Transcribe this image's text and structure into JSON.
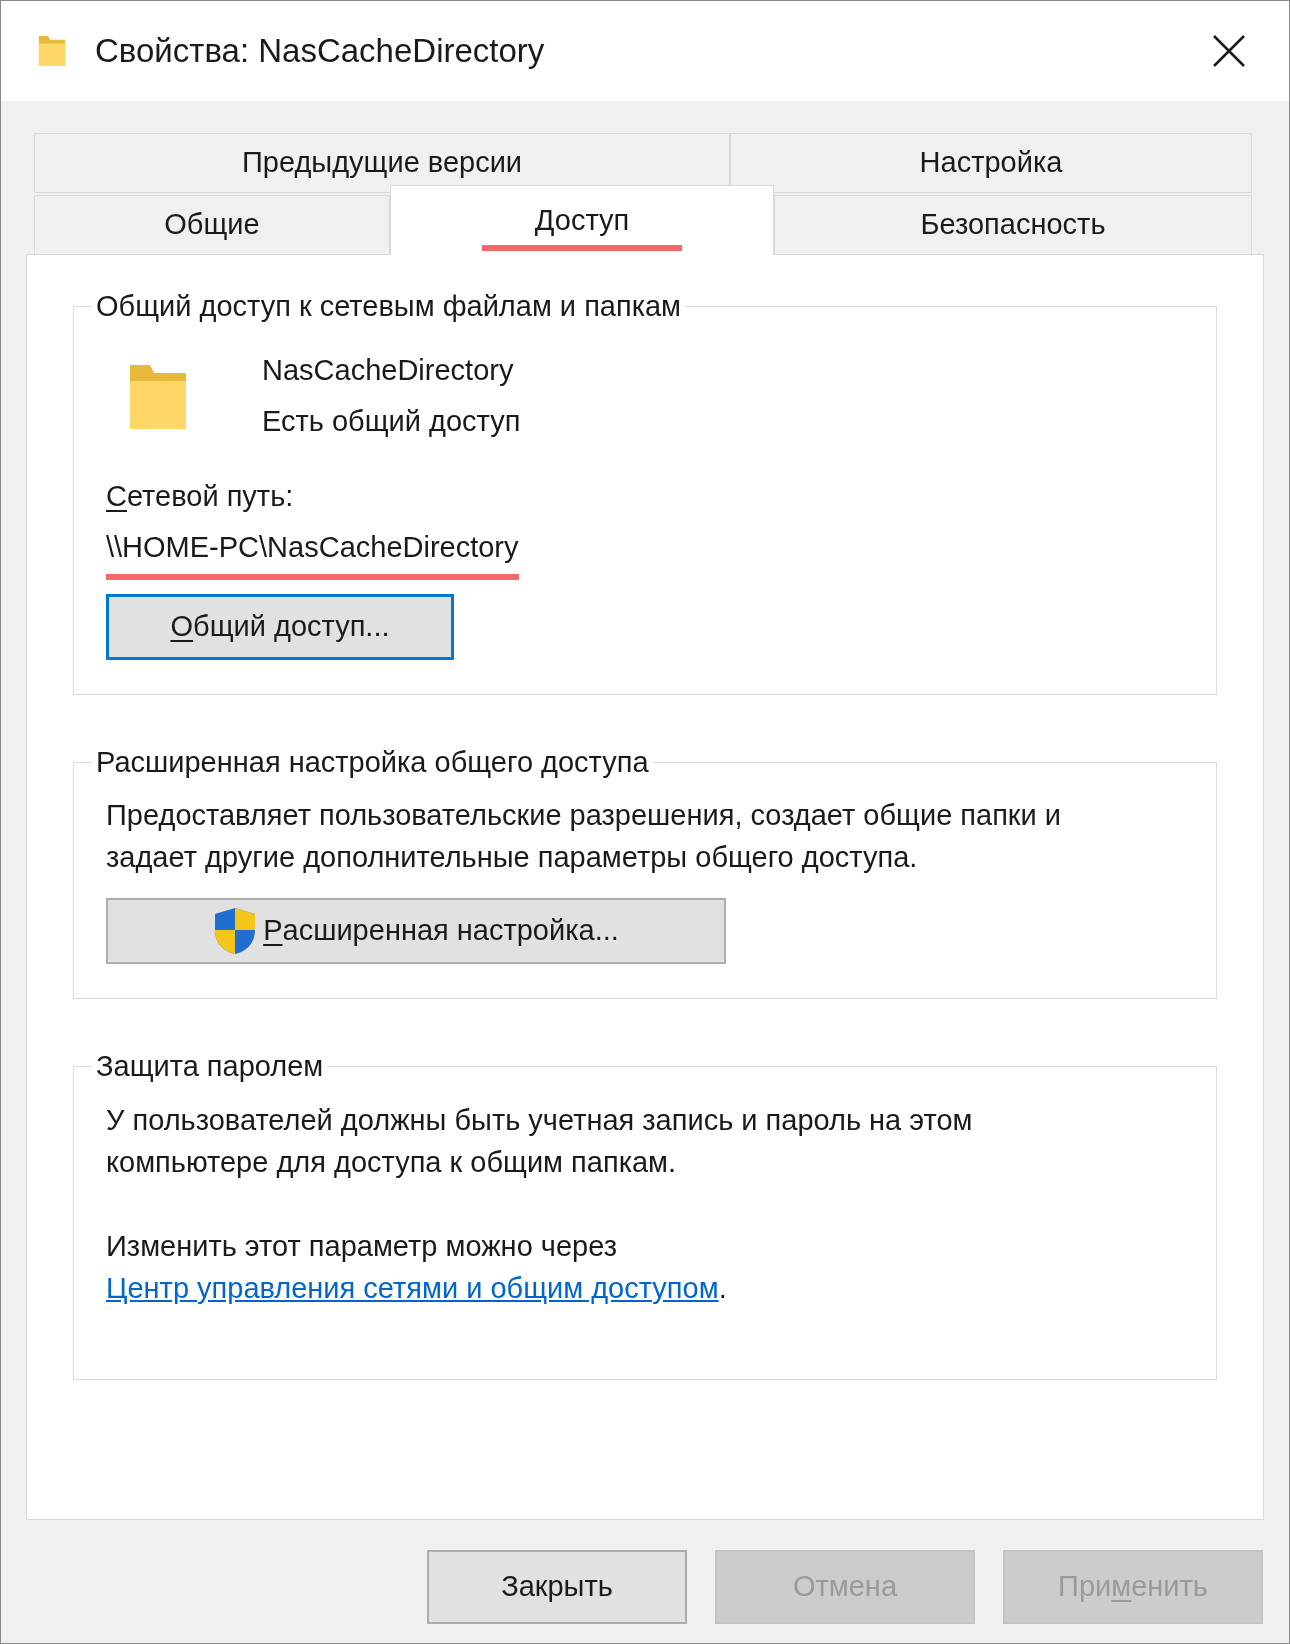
{
  "window": {
    "title": "Свойства: NasCacheDirectory"
  },
  "tab_rows": [
    [
      {
        "label": "Предыдущие версии",
        "selected": false,
        "highlighted": false
      },
      {
        "label": "Настройка",
        "selected": false,
        "highlighted": false
      }
    ],
    [
      {
        "label": "Общие",
        "selected": false,
        "highlighted": false
      },
      {
        "label": "Доступ",
        "selected": true,
        "highlighted": true
      },
      {
        "label": "Безопасность",
        "selected": false,
        "highlighted": false
      }
    ]
  ],
  "network_sharing": {
    "legend": "Общий доступ к сетевым файлам и папкам",
    "folder_name": "NasCacheDirectory",
    "status": "Есть общий доступ",
    "path_label": [
      {
        "text": "С",
        "underlined": true
      },
      {
        "text": "етевой путь:",
        "underlined": false
      }
    ],
    "path": {
      "text": "\\\\HOME-PC\\NasCacheDirectory",
      "highlighted": true
    },
    "button": {
      "parts": [
        {
          "text": "О",
          "underlined": true
        },
        {
          "text": "бщий доступ...",
          "underlined": false
        }
      ],
      "focused": true
    }
  },
  "advanced_sharing": {
    "legend": "Расширенная настройка общего доступа",
    "description": "Предоставляет пользовательские разрешения, создает общие папки и задает другие дополнительные параметры общего доступа.",
    "button": {
      "parts": [
        {
          "text": "Р",
          "underlined": true
        },
        {
          "text": "асширенная настройка...",
          "underlined": false
        }
      ],
      "focused": false
    }
  },
  "password_protection": {
    "legend": "Защита паролем",
    "description": "У пользователей должны быть учетная запись и пароль на этом компьютере для доступа к общим папкам.",
    "note": {
      "text_before": "Изменить этот параметр можно через ",
      "link": "Центр управления сетями и общим доступом",
      "text_after": "."
    }
  },
  "buttons": [
    {
      "parts": [
        {
          "text": "Закрыть",
          "underlined": false
        }
      ],
      "disabled": false
    },
    {
      "parts": [
        {
          "text": "Отмена",
          "underlined": false
        }
      ],
      "disabled": true
    },
    {
      "parts": [
        {
          "text": "При",
          "underlined": false
        },
        {
          "text": "м",
          "underlined": true
        },
        {
          "text": "енить",
          "underlined": false
        }
      ],
      "disabled": true
    }
  ]
}
